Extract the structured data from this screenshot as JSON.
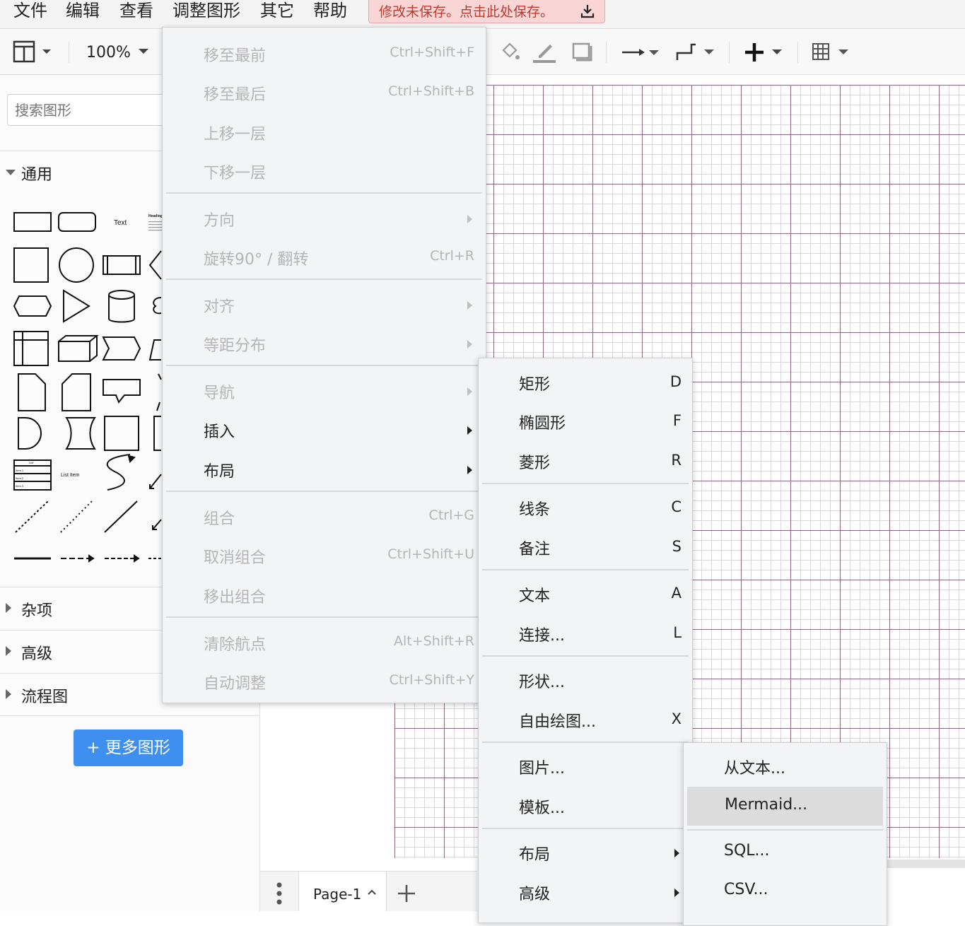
{
  "menubar": {
    "items": [
      "文件",
      "编辑",
      "查看",
      "调整图形",
      "其它",
      "帮助"
    ],
    "unsaved": "修改未保存。点击此处保存。"
  },
  "toolbar": {
    "zoom": "100%"
  },
  "sidebar": {
    "search_placeholder": "搜索图形",
    "sections": {
      "general": "通用",
      "misc": "杂项",
      "advanced": "高级",
      "flowchart": "流程图"
    },
    "shape_labels": {
      "text": "Text",
      "heading": "Heading",
      "list": "List",
      "list_items": [
        "Item 1",
        "Item 2",
        "Item 3"
      ],
      "list_item": "List Item"
    },
    "more_shapes": "+ 更多图形"
  },
  "arrange_menu": {
    "items": [
      {
        "label": "移至最前",
        "shortcut": "Ctrl+Shift+F"
      },
      {
        "label": "移至最后",
        "shortcut": "Ctrl+Shift+B"
      },
      {
        "label": "上移一层",
        "shortcut": ""
      },
      {
        "label": "下移一层",
        "shortcut": ""
      },
      {
        "label": "方向",
        "shortcut": ""
      },
      {
        "label": "旋转90° / 翻转",
        "shortcut": "Ctrl+R"
      },
      {
        "label": "对齐",
        "shortcut": ""
      },
      {
        "label": "等距分布",
        "shortcut": ""
      },
      {
        "label": "导航",
        "shortcut": ""
      },
      {
        "label": "插入",
        "shortcut": ""
      },
      {
        "label": "布局",
        "shortcut": ""
      },
      {
        "label": "组合",
        "shortcut": "Ctrl+G"
      },
      {
        "label": "取消组合",
        "shortcut": "Ctrl+Shift+U"
      },
      {
        "label": "移出组合",
        "shortcut": ""
      },
      {
        "label": "清除航点",
        "shortcut": "Alt+Shift+R"
      },
      {
        "label": "自动调整",
        "shortcut": "Ctrl+Shift+Y"
      }
    ]
  },
  "insert_menu": {
    "items": [
      {
        "label": "矩形",
        "shortcut": "D"
      },
      {
        "label": "椭圆形",
        "shortcut": "F"
      },
      {
        "label": "菱形",
        "shortcut": "R"
      },
      {
        "label": "线条",
        "shortcut": "C"
      },
      {
        "label": "备注",
        "shortcut": "S"
      },
      {
        "label": "文本",
        "shortcut": "A"
      },
      {
        "label": "连接...",
        "shortcut": "L"
      },
      {
        "label": "形状...",
        "shortcut": ""
      },
      {
        "label": "自由绘图...",
        "shortcut": "X"
      },
      {
        "label": "图片...",
        "shortcut": ""
      },
      {
        "label": "模板...",
        "shortcut": ""
      },
      {
        "label": "布局",
        "shortcut": ""
      },
      {
        "label": "高级",
        "shortcut": ""
      }
    ]
  },
  "advanced_menu": {
    "items": [
      {
        "label": "从文本..."
      },
      {
        "label": "Mermaid..."
      },
      {
        "label": "SQL..."
      },
      {
        "label": "CSV..."
      }
    ]
  },
  "pagebar": {
    "page_name": "Page-1"
  }
}
